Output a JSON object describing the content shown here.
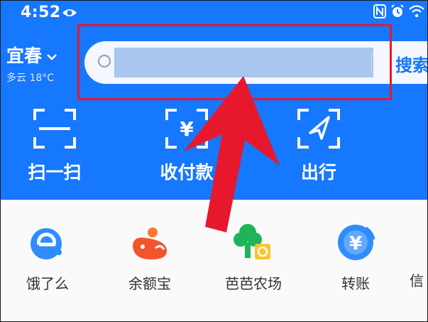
{
  "status_bar": {
    "time": "4:52"
  },
  "location": {
    "city": "宜春",
    "weather": "多云 18°C"
  },
  "search": {
    "button_label": "搜索"
  },
  "quick_actions": [
    {
      "label": "扫一扫",
      "icon": "scan-icon"
    },
    {
      "label": "收付款",
      "icon": "receive-pay-icon"
    },
    {
      "label": "出行",
      "icon": "travel-icon"
    }
  ],
  "apps": [
    {
      "label": "饿了么",
      "icon": "eleme-icon"
    },
    {
      "label": "余额宝",
      "icon": "yuebao-icon"
    },
    {
      "label": "芭芭农场",
      "icon": "baba-farm-icon"
    },
    {
      "label": "转账",
      "icon": "transfer-icon"
    },
    {
      "label": "信",
      "icon": "credit-icon"
    }
  ],
  "colors": {
    "brand_blue": "#1677ff",
    "highlight_red": "#e8182c",
    "annotation_arrow": "#e8182c"
  }
}
